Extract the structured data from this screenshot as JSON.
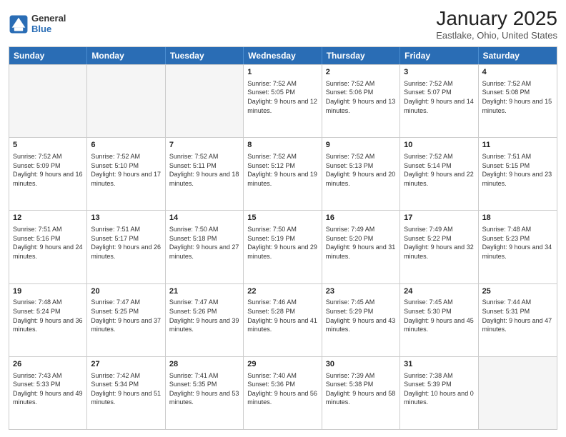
{
  "header": {
    "logo_general": "General",
    "logo_blue": "Blue",
    "month_title": "January 2025",
    "location": "Eastlake, Ohio, United States"
  },
  "days_of_week": [
    "Sunday",
    "Monday",
    "Tuesday",
    "Wednesday",
    "Thursday",
    "Friday",
    "Saturday"
  ],
  "weeks": [
    [
      {
        "day": "",
        "empty": true
      },
      {
        "day": "",
        "empty": true
      },
      {
        "day": "",
        "empty": true
      },
      {
        "day": "1",
        "sunrise": "7:52 AM",
        "sunset": "5:05 PM",
        "daylight": "9 hours and 12 minutes."
      },
      {
        "day": "2",
        "sunrise": "7:52 AM",
        "sunset": "5:06 PM",
        "daylight": "9 hours and 13 minutes."
      },
      {
        "day": "3",
        "sunrise": "7:52 AM",
        "sunset": "5:07 PM",
        "daylight": "9 hours and 14 minutes."
      },
      {
        "day": "4",
        "sunrise": "7:52 AM",
        "sunset": "5:08 PM",
        "daylight": "9 hours and 15 minutes."
      }
    ],
    [
      {
        "day": "5",
        "sunrise": "7:52 AM",
        "sunset": "5:09 PM",
        "daylight": "9 hours and 16 minutes."
      },
      {
        "day": "6",
        "sunrise": "7:52 AM",
        "sunset": "5:10 PM",
        "daylight": "9 hours and 17 minutes."
      },
      {
        "day": "7",
        "sunrise": "7:52 AM",
        "sunset": "5:11 PM",
        "daylight": "9 hours and 18 minutes."
      },
      {
        "day": "8",
        "sunrise": "7:52 AM",
        "sunset": "5:12 PM",
        "daylight": "9 hours and 19 minutes."
      },
      {
        "day": "9",
        "sunrise": "7:52 AM",
        "sunset": "5:13 PM",
        "daylight": "9 hours and 20 minutes."
      },
      {
        "day": "10",
        "sunrise": "7:52 AM",
        "sunset": "5:14 PM",
        "daylight": "9 hours and 22 minutes."
      },
      {
        "day": "11",
        "sunrise": "7:51 AM",
        "sunset": "5:15 PM",
        "daylight": "9 hours and 23 minutes."
      }
    ],
    [
      {
        "day": "12",
        "sunrise": "7:51 AM",
        "sunset": "5:16 PM",
        "daylight": "9 hours and 24 minutes."
      },
      {
        "day": "13",
        "sunrise": "7:51 AM",
        "sunset": "5:17 PM",
        "daylight": "9 hours and 26 minutes."
      },
      {
        "day": "14",
        "sunrise": "7:50 AM",
        "sunset": "5:18 PM",
        "daylight": "9 hours and 27 minutes."
      },
      {
        "day": "15",
        "sunrise": "7:50 AM",
        "sunset": "5:19 PM",
        "daylight": "9 hours and 29 minutes."
      },
      {
        "day": "16",
        "sunrise": "7:49 AM",
        "sunset": "5:20 PM",
        "daylight": "9 hours and 31 minutes."
      },
      {
        "day": "17",
        "sunrise": "7:49 AM",
        "sunset": "5:22 PM",
        "daylight": "9 hours and 32 minutes."
      },
      {
        "day": "18",
        "sunrise": "7:48 AM",
        "sunset": "5:23 PM",
        "daylight": "9 hours and 34 minutes."
      }
    ],
    [
      {
        "day": "19",
        "sunrise": "7:48 AM",
        "sunset": "5:24 PM",
        "daylight": "9 hours and 36 minutes."
      },
      {
        "day": "20",
        "sunrise": "7:47 AM",
        "sunset": "5:25 PM",
        "daylight": "9 hours and 37 minutes."
      },
      {
        "day": "21",
        "sunrise": "7:47 AM",
        "sunset": "5:26 PM",
        "daylight": "9 hours and 39 minutes."
      },
      {
        "day": "22",
        "sunrise": "7:46 AM",
        "sunset": "5:28 PM",
        "daylight": "9 hours and 41 minutes."
      },
      {
        "day": "23",
        "sunrise": "7:45 AM",
        "sunset": "5:29 PM",
        "daylight": "9 hours and 43 minutes."
      },
      {
        "day": "24",
        "sunrise": "7:45 AM",
        "sunset": "5:30 PM",
        "daylight": "9 hours and 45 minutes."
      },
      {
        "day": "25",
        "sunrise": "7:44 AM",
        "sunset": "5:31 PM",
        "daylight": "9 hours and 47 minutes."
      }
    ],
    [
      {
        "day": "26",
        "sunrise": "7:43 AM",
        "sunset": "5:33 PM",
        "daylight": "9 hours and 49 minutes."
      },
      {
        "day": "27",
        "sunrise": "7:42 AM",
        "sunset": "5:34 PM",
        "daylight": "9 hours and 51 minutes."
      },
      {
        "day": "28",
        "sunrise": "7:41 AM",
        "sunset": "5:35 PM",
        "daylight": "9 hours and 53 minutes."
      },
      {
        "day": "29",
        "sunrise": "7:40 AM",
        "sunset": "5:36 PM",
        "daylight": "9 hours and 56 minutes."
      },
      {
        "day": "30",
        "sunrise": "7:39 AM",
        "sunset": "5:38 PM",
        "daylight": "9 hours and 58 minutes."
      },
      {
        "day": "31",
        "sunrise": "7:38 AM",
        "sunset": "5:39 PM",
        "daylight": "10 hours and 0 minutes."
      },
      {
        "day": "",
        "empty": true
      }
    ]
  ]
}
